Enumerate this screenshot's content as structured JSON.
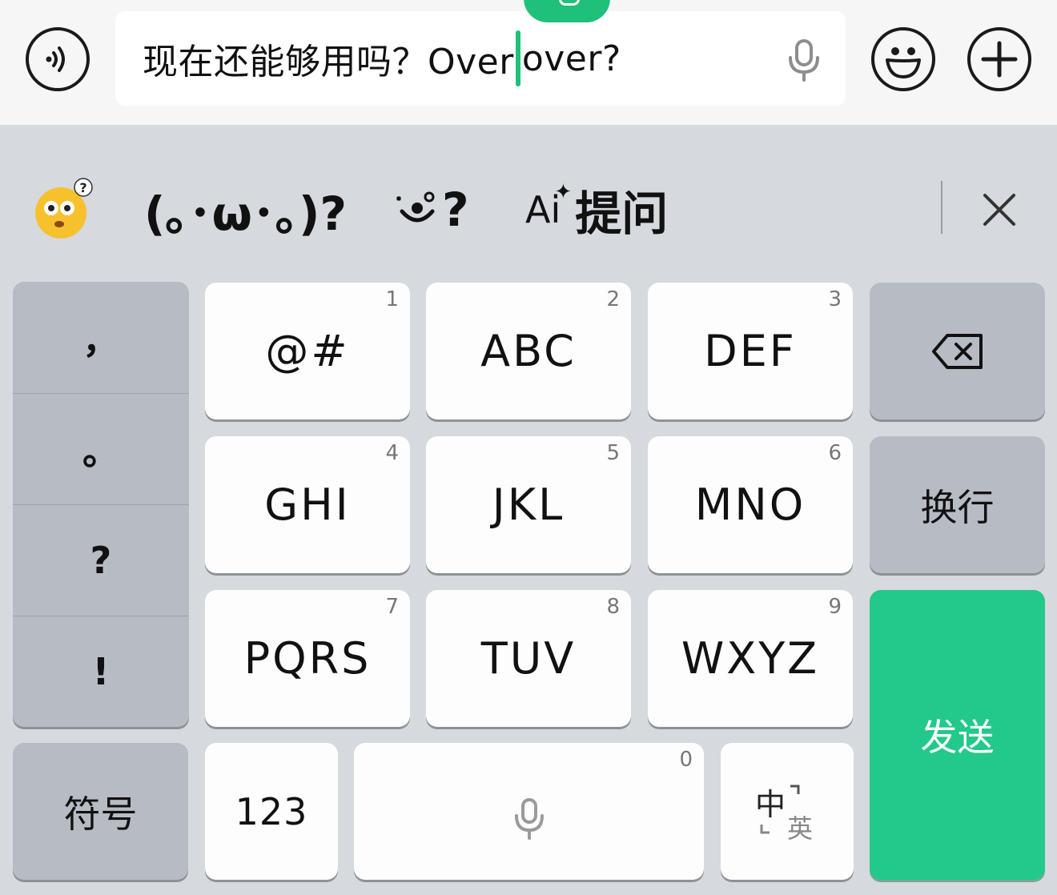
{
  "input_bar": {
    "text_before_cursor": "现在还能够用吗？Over",
    "text_after_cursor": "over?",
    "voice_icon": "voice-wave-icon",
    "mic_icon": "microphone-icon",
    "emoji_icon": "smiley-icon",
    "plus_icon": "plus-icon"
  },
  "candidates": {
    "items": [
      {
        "label": "😳",
        "icon": "confused-emoji-sticker"
      },
      {
        "label": "(｡･ω･｡)?"
      },
      {
        "label": "?",
        "icon": "face-sticker-icon"
      },
      {
        "label": "提问",
        "icon": "ai-sparkle-icon",
        "prefix": "Ai"
      }
    ],
    "close_icon": "close-icon"
  },
  "keyboard": {
    "punctuation": [
      "，",
      "。",
      "?",
      "!"
    ],
    "keys": [
      {
        "label": "@#",
        "num": "1"
      },
      {
        "label": "ABC",
        "num": "2"
      },
      {
        "label": "DEF",
        "num": "3"
      },
      {
        "label": "GHI",
        "num": "4"
      },
      {
        "label": "JKL",
        "num": "5"
      },
      {
        "label": "MNO",
        "num": "6"
      },
      {
        "label": "PQRS",
        "num": "7"
      },
      {
        "label": "TUV",
        "num": "8"
      },
      {
        "label": "WXYZ",
        "num": "9"
      }
    ],
    "backspace_icon": "backspace-icon",
    "newline_label": "换行",
    "send_label": "发送",
    "symbols_label": "符号",
    "numbers_label": "123",
    "space_num": "0",
    "space_icon": "microphone-icon",
    "lang_switch_zh": "中",
    "lang_switch_en": "英",
    "colors": {
      "accent": "#22c98b",
      "cursor": "#1fc07a",
      "key_light": "#fdfdfe",
      "key_dark": "#b7bcc4",
      "background": "#d6d9de"
    }
  }
}
